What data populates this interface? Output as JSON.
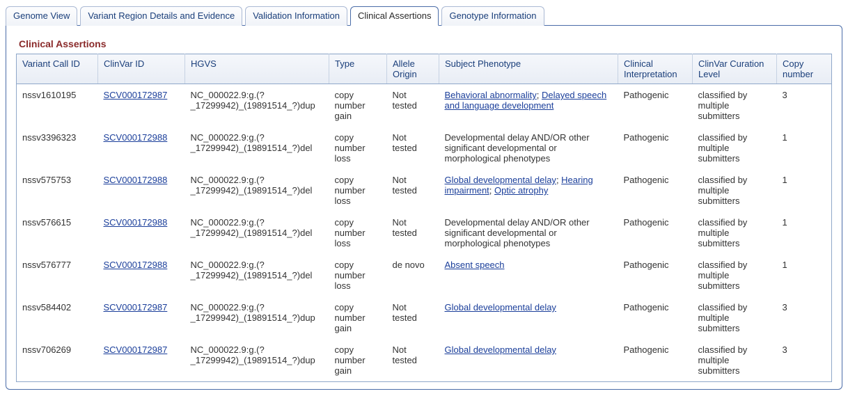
{
  "tabs": [
    {
      "label": "Genome View",
      "active": false
    },
    {
      "label": "Variant Region Details and Evidence",
      "active": false
    },
    {
      "label": "Validation Information",
      "active": false
    },
    {
      "label": "Clinical Assertions",
      "active": true
    },
    {
      "label": "Genotype Information",
      "active": false
    }
  ],
  "panel": {
    "title": "Clinical Assertions"
  },
  "columns": {
    "vcid": "Variant Call ID",
    "clinvar": "ClinVar ID",
    "hgvs": "HGVS",
    "type": "Type",
    "origin": "Allele Origin",
    "phenotype": "Subject Phenotype",
    "interp": "Clinical Interpretation",
    "curation": "ClinVar Curation Level",
    "copy": "Copy number"
  },
  "rows": [
    {
      "vcid": "nssv1610195",
      "clinvar": "SCV000172987",
      "hgvs": "NC_000022.9:g.(?_17299942)_(19891514_?)dup",
      "type": "copy number gain",
      "origin": "Not tested",
      "phenotype": [
        {
          "text": "Behavioral abnormality",
          "link": true
        },
        {
          "text": "Delayed speech and language development",
          "link": true
        }
      ],
      "interp": "Pathogenic",
      "curation": "classified by multiple submitters",
      "copy": "3"
    },
    {
      "vcid": "nssv3396323",
      "clinvar": "SCV000172988",
      "hgvs": "NC_000022.9:g.(?_17299942)_(19891514_?)del",
      "type": "copy number loss",
      "origin": "Not tested",
      "phenotype": [
        {
          "text": "Developmental delay AND/OR other significant developmental or morphological phenotypes",
          "link": false
        }
      ],
      "interp": "Pathogenic",
      "curation": "classified by multiple submitters",
      "copy": "1"
    },
    {
      "vcid": "nssv575753",
      "clinvar": "SCV000172988",
      "hgvs": "NC_000022.9:g.(?_17299942)_(19891514_?)del",
      "type": "copy number loss",
      "origin": "Not tested",
      "phenotype": [
        {
          "text": "Global developmental delay",
          "link": true
        },
        {
          "text": "Hearing impairment",
          "link": true
        },
        {
          "text": "Optic atrophy",
          "link": true
        }
      ],
      "interp": "Pathogenic",
      "curation": "classified by multiple submitters",
      "copy": "1"
    },
    {
      "vcid": "nssv576615",
      "clinvar": "SCV000172988",
      "hgvs": "NC_000022.9:g.(?_17299942)_(19891514_?)del",
      "type": "copy number loss",
      "origin": "Not tested",
      "phenotype": [
        {
          "text": "Developmental delay AND/OR other significant developmental or morphological phenotypes",
          "link": false
        }
      ],
      "interp": "Pathogenic",
      "curation": "classified by multiple submitters",
      "copy": "1"
    },
    {
      "vcid": "nssv576777",
      "clinvar": "SCV000172988",
      "hgvs": "NC_000022.9:g.(?_17299942)_(19891514_?)del",
      "type": "copy number loss",
      "origin": "de novo",
      "phenotype": [
        {
          "text": "Absent speech",
          "link": true
        }
      ],
      "interp": "Pathogenic",
      "curation": "classified by multiple submitters",
      "copy": "1"
    },
    {
      "vcid": "nssv584402",
      "clinvar": "SCV000172987",
      "hgvs": "NC_000022.9:g.(?_17299942)_(19891514_?)dup",
      "type": "copy number gain",
      "origin": "Not tested",
      "phenotype": [
        {
          "text": "Global developmental delay",
          "link": true
        }
      ],
      "interp": "Pathogenic",
      "curation": "classified by multiple submitters",
      "copy": "3"
    },
    {
      "vcid": "nssv706269",
      "clinvar": "SCV000172987",
      "hgvs": "NC_000022.9:g.(?_17299942)_(19891514_?)dup",
      "type": "copy number gain",
      "origin": "Not tested",
      "phenotype": [
        {
          "text": "Global developmental delay",
          "link": true
        }
      ],
      "interp": "Pathogenic",
      "curation": "classified by multiple submitters",
      "copy": "3"
    }
  ]
}
